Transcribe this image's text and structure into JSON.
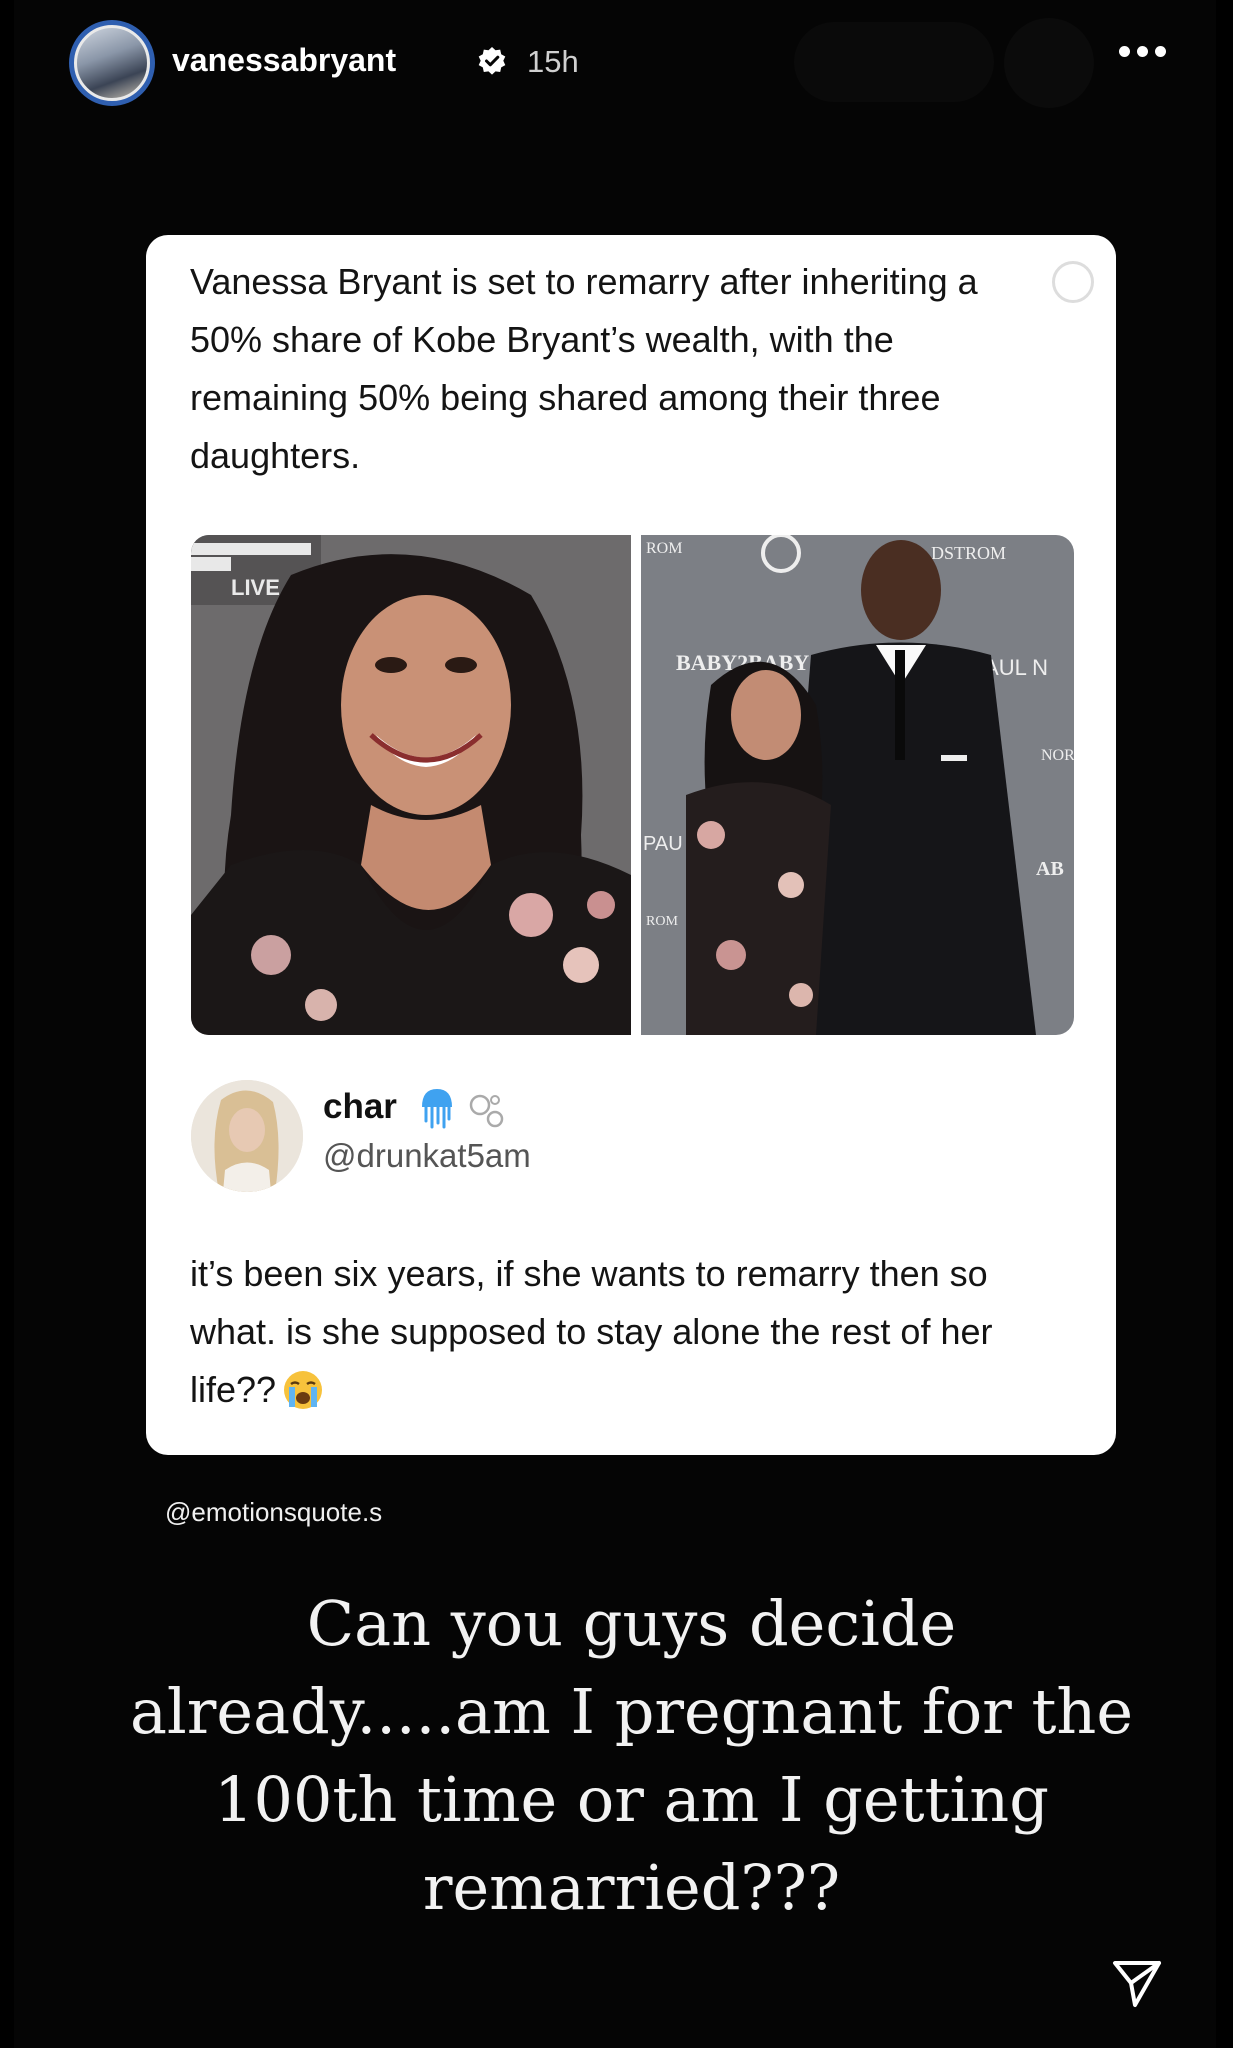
{
  "story": {
    "username": "vanessabryant",
    "verified_icon": "verified-badge-icon",
    "time_ago": "15h",
    "more_icon": "more-options-icon",
    "share_icon": "send-icon"
  },
  "tweet": {
    "text": "Vanessa Bryant is set to remarry after inheriting a 50% share of Kobe Bryant’s wealth, with the remaining 50% being shared among their three daughters.",
    "photo_left_signage": "LIVE",
    "photo_right_signage": [
      "ROM",
      "DSTROM",
      "BABY2BABY",
      "PAUL N",
      "NOR",
      "PAU",
      "ROM",
      "AB"
    ]
  },
  "reply": {
    "name": "char",
    "handle": "@drunkat5am",
    "text": "it’s been six years, if she wants to remarry then so what. is she supposed to stay alone the rest of her life??",
    "emoji": "loudly-crying-face-icon"
  },
  "credit": "@emotionsquote.s",
  "caption": "Can you guys decide already.....am I pregnant for the 100th time or am I getting remarried???",
  "colors": {
    "background": "#050505",
    "card": "#ffffff",
    "avatar_ring": "#2f5fb0",
    "verified": "#ffffff"
  }
}
